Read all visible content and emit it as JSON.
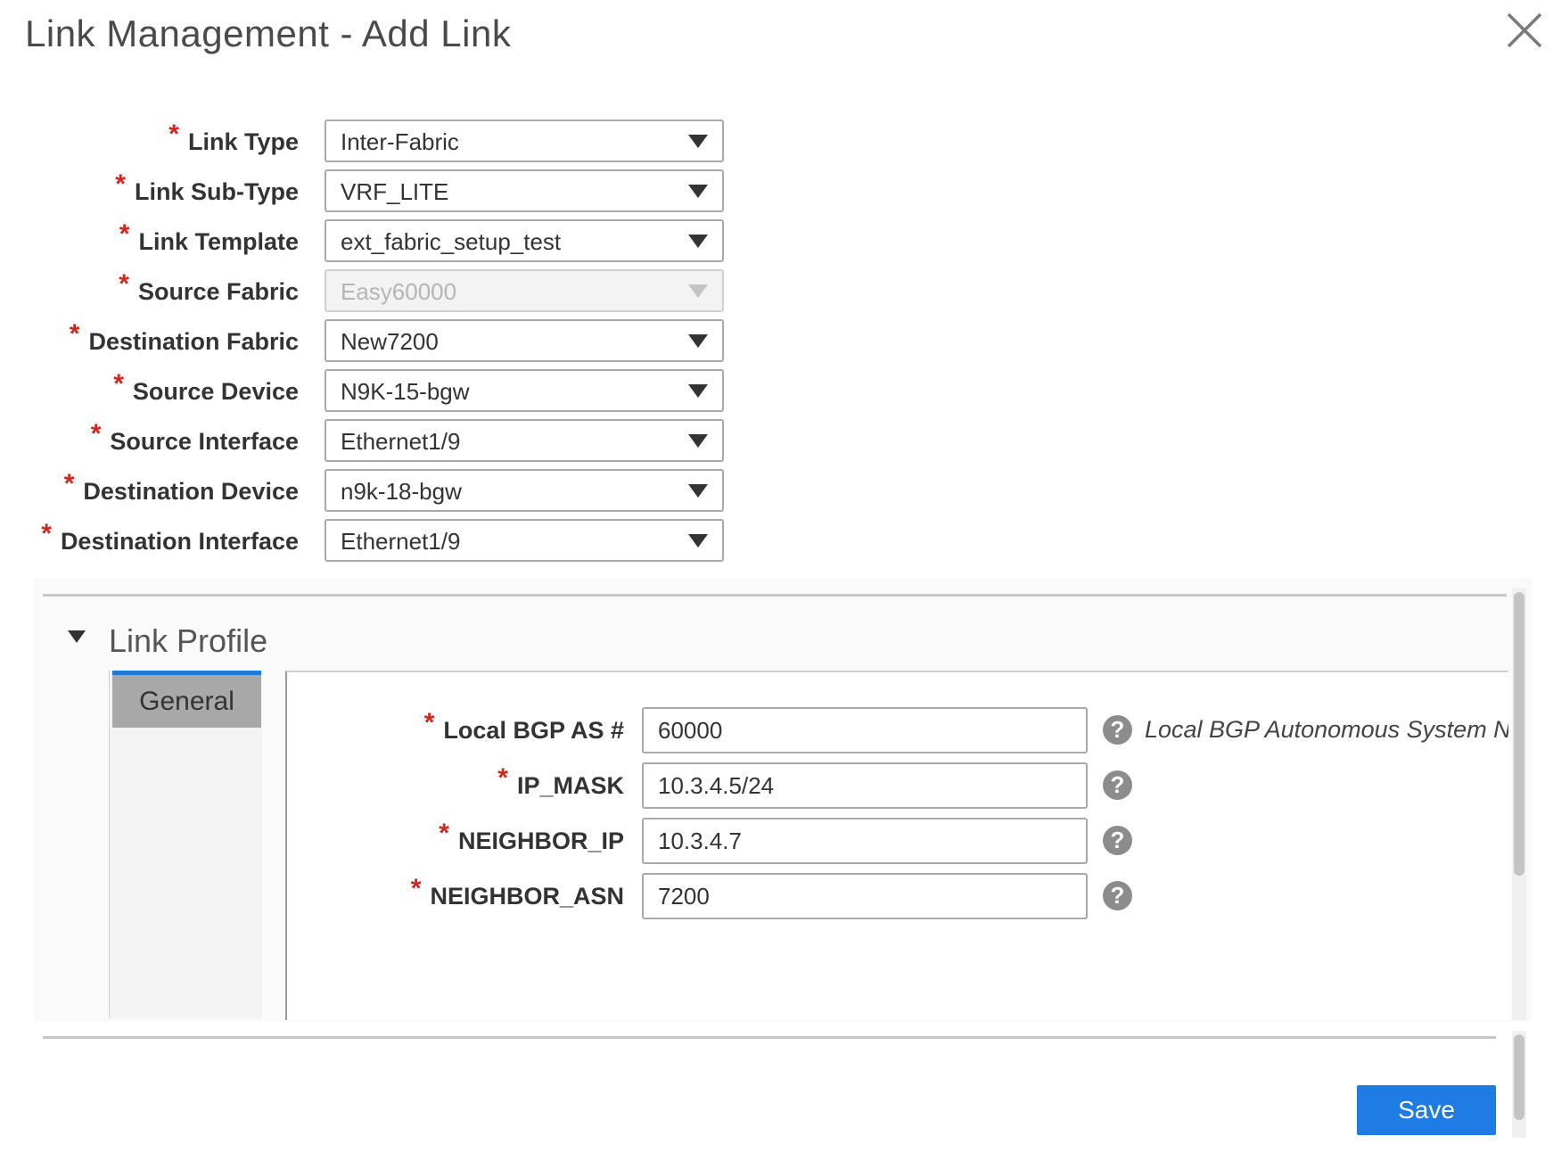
{
  "dialog": {
    "title": "Link Management - Add Link",
    "close_icon": "close-icon"
  },
  "form": {
    "required_marker": "*",
    "fields": [
      {
        "label": "Link Type",
        "value": "Inter-Fabric",
        "disabled": false
      },
      {
        "label": "Link Sub-Type",
        "value": "VRF_LITE",
        "disabled": false
      },
      {
        "label": "Link Template",
        "value": "ext_fabric_setup_test",
        "disabled": false
      },
      {
        "label": "Source Fabric",
        "value": "Easy60000",
        "disabled": true
      },
      {
        "label": "Destination Fabric",
        "value": "New7200",
        "disabled": false
      },
      {
        "label": "Source Device",
        "value": "N9K-15-bgw",
        "disabled": false
      },
      {
        "label": "Source Interface",
        "value": "Ethernet1/9",
        "disabled": false
      },
      {
        "label": "Destination Device",
        "value": "n9k-18-bgw",
        "disabled": false
      },
      {
        "label": "Destination Interface",
        "value": "Ethernet1/9",
        "disabled": false
      }
    ]
  },
  "link_profile": {
    "title": "Link Profile",
    "tabs": [
      {
        "label": "General",
        "active": true
      }
    ],
    "params": [
      {
        "label": "Local BGP AS #",
        "value": "60000",
        "hint": "Local BGP Autonomous System Nu"
      },
      {
        "label": "IP_MASK",
        "value": "10.3.4.5/24",
        "hint": ""
      },
      {
        "label": "NEIGHBOR_IP",
        "value": "10.3.4.7",
        "hint": ""
      },
      {
        "label": "NEIGHBOR_ASN",
        "value": "7200",
        "hint": ""
      }
    ],
    "help_glyph": "?"
  },
  "footer": {
    "save_label": "Save"
  }
}
